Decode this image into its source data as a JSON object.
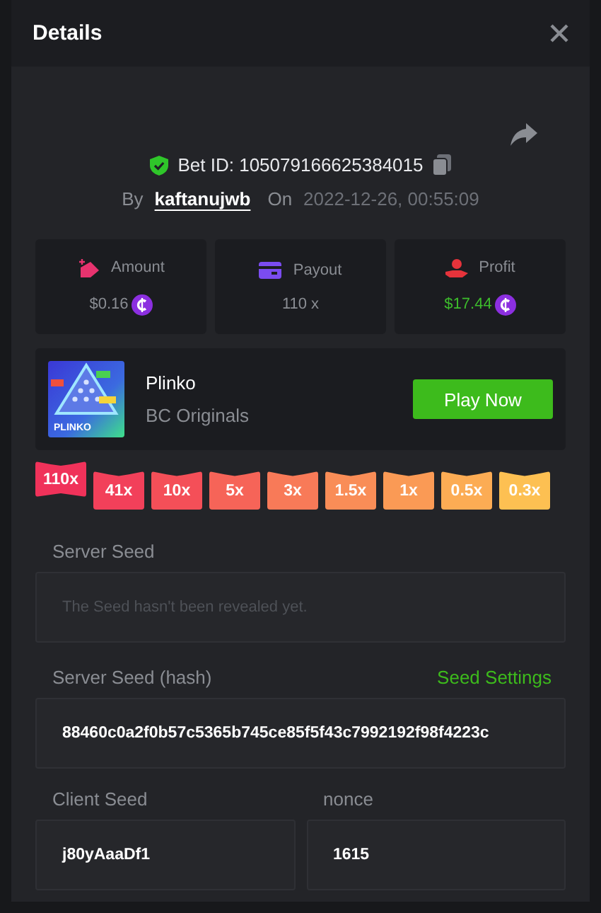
{
  "dialog": {
    "title": "Details"
  },
  "bet": {
    "verified": true,
    "id_label": "Bet ID: 105079166625384015",
    "by_label": "By",
    "user": "kaftanujwb",
    "on_label": "On",
    "date": "2022-12-26, 00:55:09"
  },
  "stats": [
    {
      "kind": "amount",
      "label": "Amount",
      "value": "$0.16",
      "coin": true,
      "positive": false
    },
    {
      "kind": "payout",
      "label": "Payout",
      "value": "110 x",
      "coin": false,
      "positive": false
    },
    {
      "kind": "profit",
      "label": "Profit",
      "value": "$17.44",
      "coin": true,
      "positive": true
    }
  ],
  "game": {
    "thumbnail_text": "PLINKO",
    "name": "Plinko",
    "provider": "BC Originals",
    "button": "Play Now"
  },
  "multipliers": [
    {
      "label": "110x",
      "selected": true,
      "color": "#f0325a"
    },
    {
      "label": "41x",
      "selected": false,
      "color": "#f2405a"
    },
    {
      "label": "10x",
      "selected": false,
      "color": "#f44f58"
    },
    {
      "label": "5x",
      "selected": false,
      "color": "#f66458"
    },
    {
      "label": "3x",
      "selected": false,
      "color": "#f87a58"
    },
    {
      "label": "1.5x",
      "selected": false,
      "color": "#f98d57"
    },
    {
      "label": "1x",
      "selected": false,
      "color": "#fa9a55"
    },
    {
      "label": "0.5x",
      "selected": false,
      "color": "#fcac54"
    },
    {
      "label": "0.3x",
      "selected": false,
      "color": "#fdc052"
    }
  ],
  "server_seed": {
    "label": "Server Seed",
    "placeholder": "The Seed hasn't been revealed yet."
  },
  "server_seed_hash": {
    "label": "Server Seed (hash)",
    "link": "Seed Settings",
    "value": "88460c0a2f0b57c5365b745ce85f5f43c7992192f98f4223c"
  },
  "client_seed": {
    "label": "Client Seed",
    "value": "j80yAaaDf1"
  },
  "nonce": {
    "label": "nonce",
    "value": "1615"
  }
}
